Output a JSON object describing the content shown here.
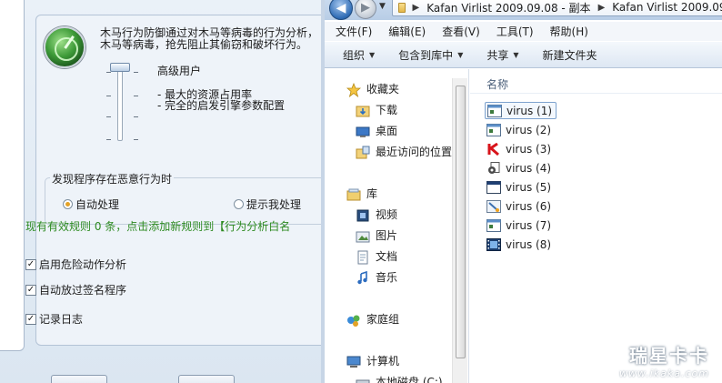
{
  "left": {
    "desc_line1": "木马行为防御通过对木马等病毒的行为分析，",
    "desc_line2": "木马等病毒，抢先阻止其偷窃和破坏行为。",
    "level_label": "高级用户",
    "feature_1": "最大的资源占用率",
    "feature_2": "完全的启发引擎参数配置",
    "detect_group_title": "发现程序存在恶意行为时",
    "radio_auto": "自动处理",
    "radio_prompt": "提示我处理",
    "rules_link": "现有有效规则 0 条，点击添加新规则到【行为分析白名",
    "check_danger": "启用危险动作分析",
    "check_sign": "自动放过签名程序",
    "check_log": "记录日志",
    "check_mark": "✓"
  },
  "explorer": {
    "breadcrumb": [
      "Kafan Virlist 2009.09.08 - 副本",
      "Kafan Virlist 2009.09.0"
    ],
    "menu": [
      "文件(F)",
      "编辑(E)",
      "查看(V)",
      "工具(T)",
      "帮助(H)"
    ],
    "toolbar": {
      "organize": "组织",
      "include_library": "包含到库中",
      "share": "共享",
      "new_folder": "新建文件夹",
      "arrow": "▼"
    },
    "nav": {
      "favorites": "收藏夹",
      "downloads": "下载",
      "desktop": "桌面",
      "recent": "最近访问的位置",
      "libraries": "库",
      "videos": "视频",
      "pictures": "图片",
      "documents": "文档",
      "music": "音乐",
      "homegroup": "家庭组",
      "computer": "计算机",
      "local_disk": "本地磁盘 (C:)"
    },
    "column_name": "名称",
    "files": [
      {
        "name": "virus (1)",
        "icon": "app-window-icon"
      },
      {
        "name": "virus (2)",
        "icon": "app-window-icon"
      },
      {
        "name": "virus (3)",
        "icon": "red-k-icon"
      },
      {
        "name": "virus (4)",
        "icon": "script-gear-icon"
      },
      {
        "name": "virus (5)",
        "icon": "window-blue-icon"
      },
      {
        "name": "virus (6)",
        "icon": "installer-icon"
      },
      {
        "name": "virus (7)",
        "icon": "app-window-icon"
      },
      {
        "name": "virus (8)",
        "icon": "film-icon"
      }
    ]
  },
  "watermark": {
    "logo": "瑞星卡卡",
    "url": "www.ikaka.com"
  }
}
